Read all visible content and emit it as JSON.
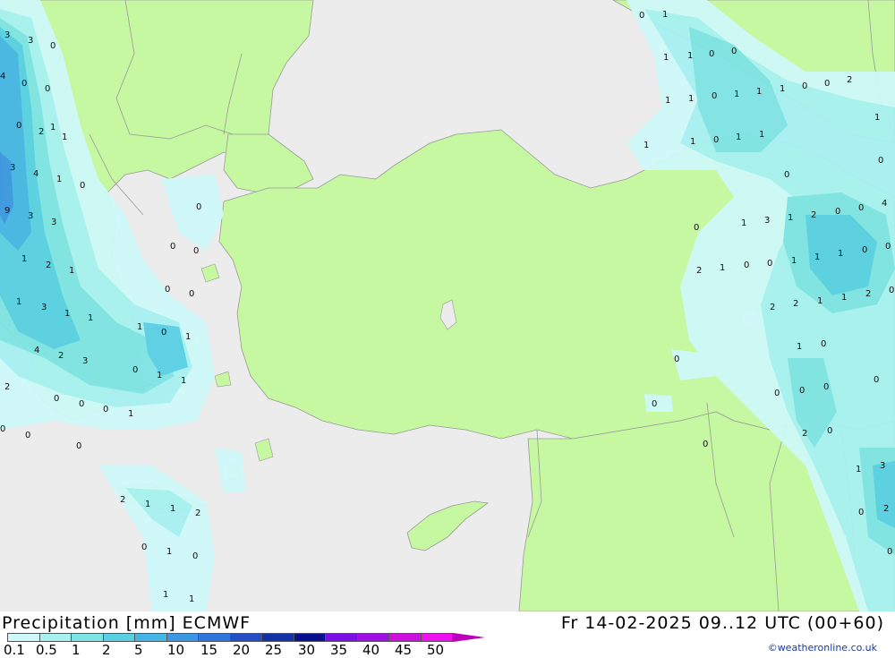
{
  "title": "Precipitation [mm] ECMWF",
  "valid_time": "Fr 14-02-2025 09..12 UTC (00+60)",
  "credit": "©weatheronline.co.uk",
  "colors": {
    "sea": "#ececec",
    "land": "#c6f7a1",
    "border": "#9a9a9a"
  },
  "legend": {
    "ticks": [
      "0.1",
      "0.5",
      "1",
      "2",
      "5",
      "10",
      "15",
      "20",
      "25",
      "30",
      "35",
      "40",
      "45",
      "50"
    ],
    "colors": [
      "#cff9f9",
      "#a8f1f1",
      "#7fe4e4",
      "#59cfe4",
      "#45b5e6",
      "#3b96e3",
      "#2f75dc",
      "#2450c5",
      "#1233a8",
      "#080f8f",
      "#7a10e6",
      "#a010e6",
      "#cc10e0",
      "#ee10ee",
      "#bb00bb"
    ]
  },
  "map_values": [
    "3",
    "3",
    "0",
    "4",
    "0",
    "0",
    "0",
    "2",
    "1",
    "1",
    "3",
    "4",
    "1",
    "0",
    "9",
    "3",
    "3",
    "1",
    "2",
    "1",
    "1",
    "3",
    "1",
    "1",
    "4",
    "2",
    "3",
    "2",
    "0",
    "0",
    "0",
    "0",
    "1",
    "0",
    "0",
    "0",
    "0",
    "0",
    "1",
    "0",
    "0",
    "0",
    "1",
    "0",
    "1",
    "1",
    "2",
    "1",
    "1",
    "2",
    "0",
    "1",
    "0",
    "1",
    "1",
    "0",
    "1",
    "1",
    "1",
    "0",
    "0",
    "1",
    "1",
    "0",
    "1",
    "1",
    "1",
    "0",
    "0",
    "2",
    "1",
    "1",
    "0",
    "1",
    "1",
    "1",
    "0",
    "0",
    "0",
    "1",
    "3",
    "1",
    "2",
    "0",
    "0",
    "4",
    "2",
    "1",
    "0",
    "0",
    "1",
    "1",
    "1",
    "0",
    "0",
    "2",
    "2",
    "1",
    "1",
    "2",
    "0",
    "1",
    "0",
    "0",
    "0",
    "0",
    "0",
    "0",
    "0",
    "2",
    "0",
    "0",
    "1",
    "3",
    "0",
    "2",
    "0"
  ]
}
